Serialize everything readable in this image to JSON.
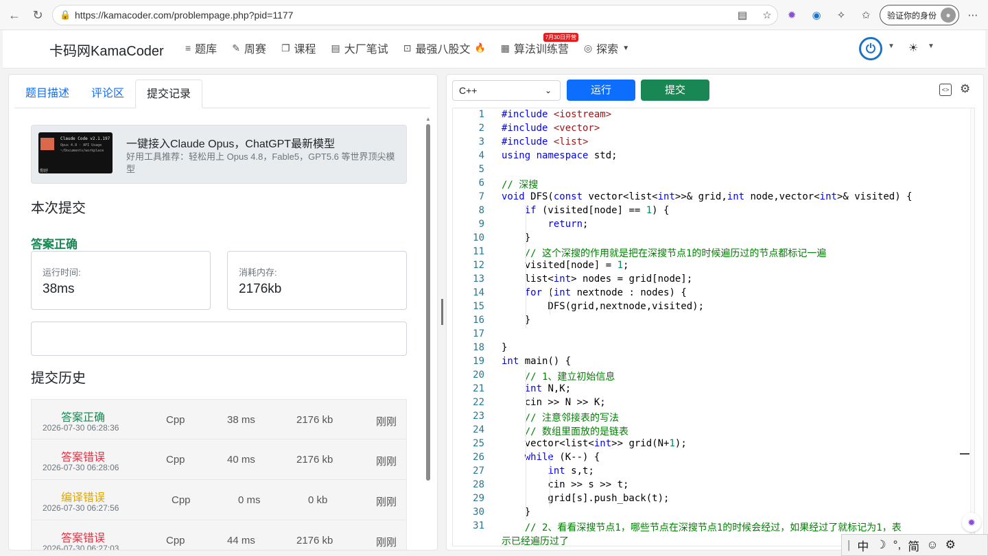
{
  "browser": {
    "url": "https://kamacoder.com/problempage.php?pid=1177",
    "verify_label": "验证你的身份"
  },
  "header": {
    "brand": "卡码网KamaCoder",
    "nav": [
      {
        "label": "题库",
        "icon": "≡"
      },
      {
        "label": "周赛",
        "icon": "✎"
      },
      {
        "label": "课程",
        "icon": "❐"
      },
      {
        "label": "大厂笔试",
        "icon": "▤"
      },
      {
        "label": "最强八股文",
        "icon": "⊡"
      },
      {
        "label": "算法训练营",
        "icon": "▦"
      },
      {
        "label": "探索",
        "icon": "◎"
      }
    ],
    "badge": "7月30日开营",
    "fire": "🔥"
  },
  "left": {
    "tabs": [
      "题目描述",
      "评论区",
      "提交记录"
    ],
    "ad": {
      "title": "一键接入Claude Opus，ChatGPT最新模型",
      "desc": "好用工具推荐：轻松用上 Opus 4.8，Fable5，GPT5.6 等世界顶尖模型",
      "thumb_l1": "Claude Code v2.1.197",
      "thumb_l2": "Opus 4.8 · API Usage",
      "thumb_l3": "~/Documents/workplace",
      "thumb_l4": "你好"
    },
    "this_submission": "本次提交",
    "result": "答案正确",
    "runtime_label": "运行时间:",
    "runtime_value": "38ms",
    "memory_label": "消耗内存:",
    "memory_value": "2176kb",
    "history_title": "提交历史",
    "history": [
      {
        "status": "答案正确",
        "type": "ok",
        "date": "2026-07-30 06:28:36",
        "lang": "Cpp",
        "time": "38 ms",
        "mem": "2176 kb",
        "when": "刚刚"
      },
      {
        "status": "答案错误",
        "type": "bad",
        "date": "2026-07-30 06:28:06",
        "lang": "Cpp",
        "time": "40 ms",
        "mem": "2176 kb",
        "when": "刚刚"
      },
      {
        "status": "编译错误",
        "type": "cmp",
        "date": "2026-07-30 06:27:56",
        "lang": "Cpp",
        "time": "0 ms",
        "mem": "0 kb",
        "when": "刚刚"
      },
      {
        "status": "答案错误",
        "type": "bad",
        "date": "2026-07-30 06:27:03",
        "lang": "Cpp",
        "time": "44 ms",
        "mem": "2176 kb",
        "when": "刚刚"
      }
    ]
  },
  "right": {
    "language": "C++",
    "run_label": "运行",
    "submit_label": "提交",
    "code": [
      "#include <iostream>",
      "#include <vector>",
      "#include <list>",
      "using namespace std;",
      "",
      "// 深搜",
      "void DFS(const vector<list<int>>& grid,int node,vector<int>& visited) {",
      "    if (visited[node] == 1) {",
      "        return;",
      "    }",
      "    // 这个深搜的作用就是把在深搜节点1的时候遍历过的节点都标记一遍",
      "    visited[node] = 1;",
      "    list<int> nodes = grid[node];",
      "    for (int nextnode : nodes) {",
      "        DFS(grid,nextnode,visited);",
      "    }",
      "",
      "}",
      "int main() {",
      "    // 1、建立初始信息",
      "    int N,K;",
      "    cin >> N >> K;",
      "    // 注意邻接表的写法",
      "    // 数组里面放的是链表",
      "    vector<list<int>> grid(N+1);",
      "    while (K--) {",
      "        int s,t;",
      "        cin >> s >> t;",
      "        grid[s].push_back(t);",
      "    }",
      "    // 2、看看深搜节点1，哪些节点在深搜节点1的时候会经过，如果经过了就标记为1，表",
      "示已经遍历过了"
    ],
    "line_numbers": [
      "1",
      "2",
      "3",
      "4",
      "5",
      "6",
      "7",
      "8",
      "9",
      "10",
      "11",
      "12",
      "13",
      "14",
      "15",
      "16",
      "17",
      "18",
      "19",
      "20",
      "21",
      "22",
      "23",
      "24",
      "25",
      "26",
      "27",
      "28",
      "29",
      "30",
      "31",
      ""
    ]
  },
  "ime": [
    "中",
    "☽",
    "°,",
    "简",
    "☺",
    "⚙"
  ]
}
